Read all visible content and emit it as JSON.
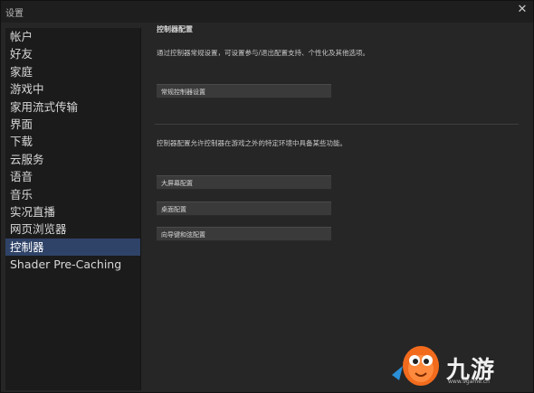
{
  "window": {
    "title": "设置",
    "close_glyph": "✕"
  },
  "sidebar": {
    "items": [
      {
        "label": "帐户"
      },
      {
        "label": "好友"
      },
      {
        "label": "家庭"
      },
      {
        "label": "游戏中"
      },
      {
        "label": "家用流式传输"
      },
      {
        "label": "界面"
      },
      {
        "label": "下载"
      },
      {
        "label": "云服务"
      },
      {
        "label": "语音"
      },
      {
        "label": "音乐"
      },
      {
        "label": "实况直播"
      },
      {
        "label": "网页浏览器"
      },
      {
        "label": "控制器",
        "active": true
      },
      {
        "label": "Shader Pre-Caching"
      }
    ]
  },
  "main": {
    "section_title": "控制器配置",
    "desc1": "通过控制器常规设置，可设置参与/退出配置支持、个性化及其他选项。",
    "btn_general": "常规控制器设置",
    "desc2": "控制器配置允许控制器在游戏之外的特定环境中具备某些功能。",
    "btn_bigpicture": "大屏幕配置",
    "btn_desktop": "桌面配置",
    "btn_guide": "向导键和弦配置"
  },
  "watermark": {
    "text": "九游",
    "sub": "www.9game.cn"
  },
  "colors": {
    "active_item": "#2f4368",
    "background": "#262626",
    "sidebar_bg": "#1b1b1b",
    "button_bg": "#3a3a3a"
  }
}
